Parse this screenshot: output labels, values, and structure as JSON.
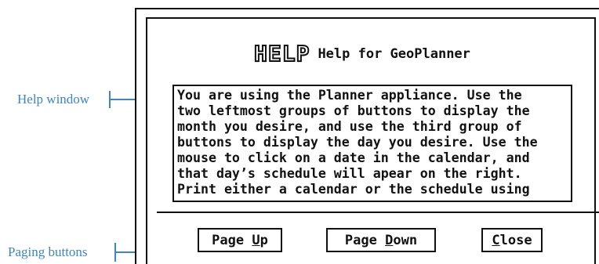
{
  "callouts": {
    "help_window": "Help window",
    "paging_buttons": "Paging buttons"
  },
  "dialog": {
    "logo_text": "HELP",
    "title": "Help for GeoPlanner",
    "text_lines": [
      "You are using the Planner appliance. Use the",
      "two leftmost groups of buttons to display the",
      "month you desire, and use the third group of",
      "buttons to display the day you desire. Use the",
      "mouse to click on a date in the calendar, and",
      "that day’s schedule will apear on the right.",
      "Print either a calendar or the schedule using"
    ],
    "buttons": {
      "page_up": {
        "pre": "Page ",
        "accel": "U",
        "post": "p"
      },
      "page_down": {
        "pre": "Page ",
        "accel": "D",
        "post": "own"
      },
      "close": {
        "pre": "",
        "accel": "C",
        "post": "lose"
      }
    }
  },
  "colors": {
    "callout": "#3a86c9",
    "ink": "#111111"
  }
}
